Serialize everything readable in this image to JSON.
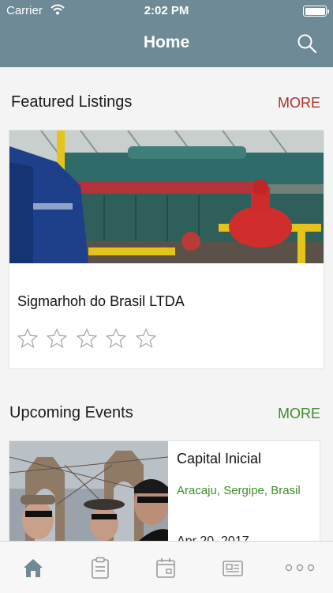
{
  "status_bar": {
    "carrier": "Carrier",
    "time": "2:02 PM"
  },
  "nav": {
    "title": "Home"
  },
  "featured": {
    "heading": "Featured Listings",
    "more_label": "MORE",
    "more_color": "#b0302a",
    "listing": {
      "name": "Sigmarhoh do Brasil LTDA",
      "rating": 0,
      "max_rating": 5
    }
  },
  "events": {
    "heading": "Upcoming Events",
    "more_label": "MORE",
    "more_color": "#3f8c2c",
    "event": {
      "title": "Capital Inicial",
      "location": "Aracaju, Sergipe, Brasil",
      "date": "Apr 20, 2017"
    }
  },
  "colors": {
    "nav_bar": "#6e8a96",
    "accent_green": "#3f8c2c",
    "accent_red": "#b0302a",
    "tab_active": "#6e8a96"
  },
  "tabbar": {
    "tabs": [
      {
        "icon": "home-icon",
        "active": true
      },
      {
        "icon": "clipboard-icon",
        "active": false
      },
      {
        "icon": "calendar-icon",
        "active": false
      },
      {
        "icon": "newspaper-icon",
        "active": false
      },
      {
        "icon": "more-dots-icon",
        "active": false
      }
    ]
  }
}
